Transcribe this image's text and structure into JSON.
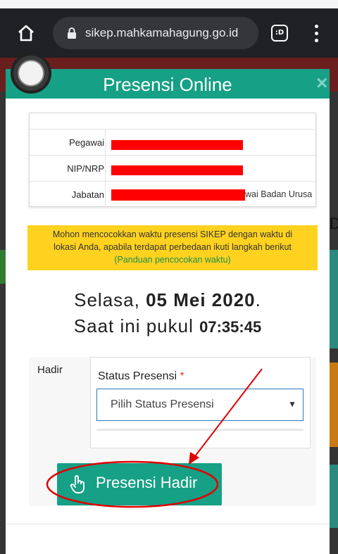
{
  "browser": {
    "url": "sikep.mahkamahagung.go.id",
    "tabs_label": ":D"
  },
  "page_edge_char": "D",
  "modal": {
    "title": "Presensi Online",
    "close_label": "×",
    "info_rows": [
      {
        "label": "Pegawai",
        "value": ""
      },
      {
        "label": "NIP/NRP",
        "value": ""
      },
      {
        "label": "Jabatan",
        "value": "wai Badan Urusa"
      }
    ],
    "notice": {
      "line1": "Mohon mencocokkan waktu presensi SIKEP dengan waktu di",
      "line2": "lokasi Anda, apabila terdapat perbedaan ikuti langkah berikut",
      "link": "(Panduan pencocokan waktu)"
    },
    "date": {
      "day": "Selasa,",
      "date": "05 Mei 2020",
      "suffix": "."
    },
    "time": {
      "prefix": "Saat ini pukul",
      "clock": "07:35:45"
    },
    "form": {
      "hadir_label": "Hadir",
      "status_label": "Status Presensi",
      "required_mark": "*",
      "select_value": "Pilih Status Presensi",
      "select_caret": "▼"
    },
    "submit_label": "Presensi Hadir"
  },
  "colors": {
    "teal": "#16a085",
    "notice_yellow": "#ffd21f",
    "annotation_red": "#e00000"
  }
}
